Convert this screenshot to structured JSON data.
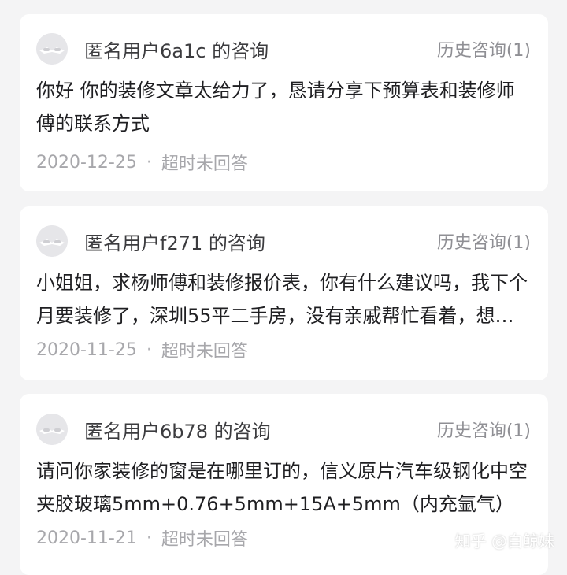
{
  "consultations": [
    {
      "user_title": "匿名用户6a1c 的咨询",
      "history_label": "历史咨询(1)",
      "question": "你好 你的装修文章太给力了，恳请分享下预算表和装修师傅的联系方式",
      "date": "2020-12-25",
      "separator": "·",
      "status": "超时未回答"
    },
    {
      "user_title": "匿名用户f271 的咨询",
      "history_label": "历史咨询(1)",
      "question": "小姐姐，求杨师傅和装修报价表，你有什么建议吗，我下个月要装修了，深圳55平二手房，没有亲戚帮忙看着，想请教一下",
      "date": "2020-11-25",
      "separator": "·",
      "status": "超时未回答"
    },
    {
      "user_title": "匿名用户6b78 的咨询",
      "history_label": "历史咨询(1)",
      "question": "请问你家装修的窗是在哪里订的，信义原片汽车级钢化中空夹胶玻璃5mm+0.76+5mm+15A+5mm（内充氩气）",
      "date": "2020-11-21",
      "separator": "·",
      "status": "超时未回答"
    }
  ],
  "watermark": "知乎 @白鲸妹",
  "colors": {
    "background": "#f4f4f5",
    "card": "#ffffff",
    "title_text": "#3c3c3f",
    "body_text": "#1f1f22",
    "meta_text": "#a7a7ab",
    "history_text": "#8f8f94"
  }
}
